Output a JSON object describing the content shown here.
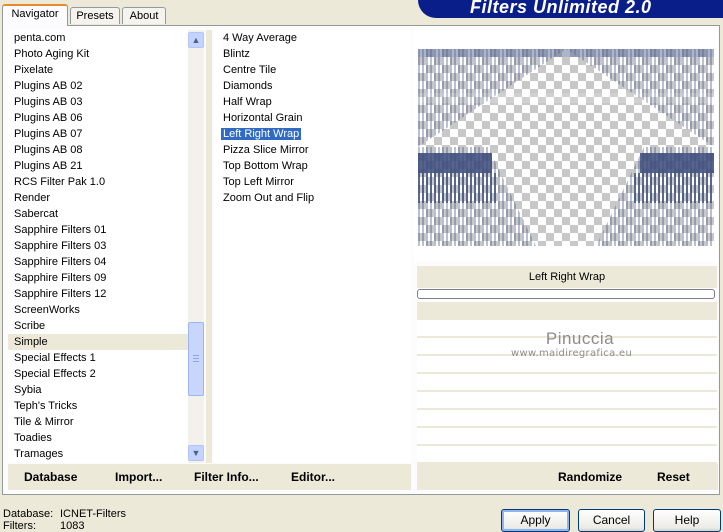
{
  "tabs": [
    {
      "label": "Navigator",
      "active": true
    },
    {
      "label": "Presets",
      "active": false
    },
    {
      "label": "About",
      "active": false
    }
  ],
  "banner_title": "Filters Unlimited 2.0",
  "categories": [
    "penta.com",
    "Photo Aging Kit",
    "Pixelate",
    "Plugins AB 02",
    "Plugins AB 03",
    "Plugins AB 06",
    "Plugins AB 07",
    "Plugins AB 08",
    "Plugins AB 21",
    "RCS Filter Pak 1.0",
    "Render",
    "Sabercat",
    "Sapphire Filters 01",
    "Sapphire Filters 03",
    "Sapphire Filters 04",
    "Sapphire Filters 09",
    "Sapphire Filters 12",
    "ScreenWorks",
    "Scribe",
    "Simple",
    "Special Effects 1",
    "Special Effects 2",
    "Sybia",
    "Teph's Tricks",
    "Tile & Mirror",
    "Toadies",
    "Tramages"
  ],
  "selected_category": "Simple",
  "filters": [
    "4 Way Average",
    "Blintz",
    "Centre Tile",
    "Diamonds",
    "Half Wrap",
    "Horizontal Grain",
    "Left Right Wrap",
    "Pizza Slice Mirror",
    "Top Bottom Wrap",
    "Top Left Mirror",
    "Zoom Out and Flip"
  ],
  "selected_filter": "Left Right Wrap",
  "left_buttons": {
    "database": "Database",
    "import": "Import...",
    "filter_info": "Filter Info...",
    "editor": "Editor..."
  },
  "filter_name": "Left Right Wrap",
  "progress": 0,
  "watermark": {
    "name": "Pinuccia",
    "url": "www.maidiregrafica.eu"
  },
  "right_buttons": {
    "randomize": "Randomize",
    "reset": "Reset"
  },
  "status": {
    "database_label": "Database:",
    "database_value": "ICNET-Filters",
    "filters_label": "Filters:",
    "filters_value": "1083"
  },
  "dialog_buttons": {
    "apply": "Apply",
    "cancel": "Cancel",
    "help": "Help"
  },
  "colors": {
    "selection": "#316ac5",
    "banner": "#0a1e8a",
    "preview_stripes": "#3a4a7a"
  }
}
